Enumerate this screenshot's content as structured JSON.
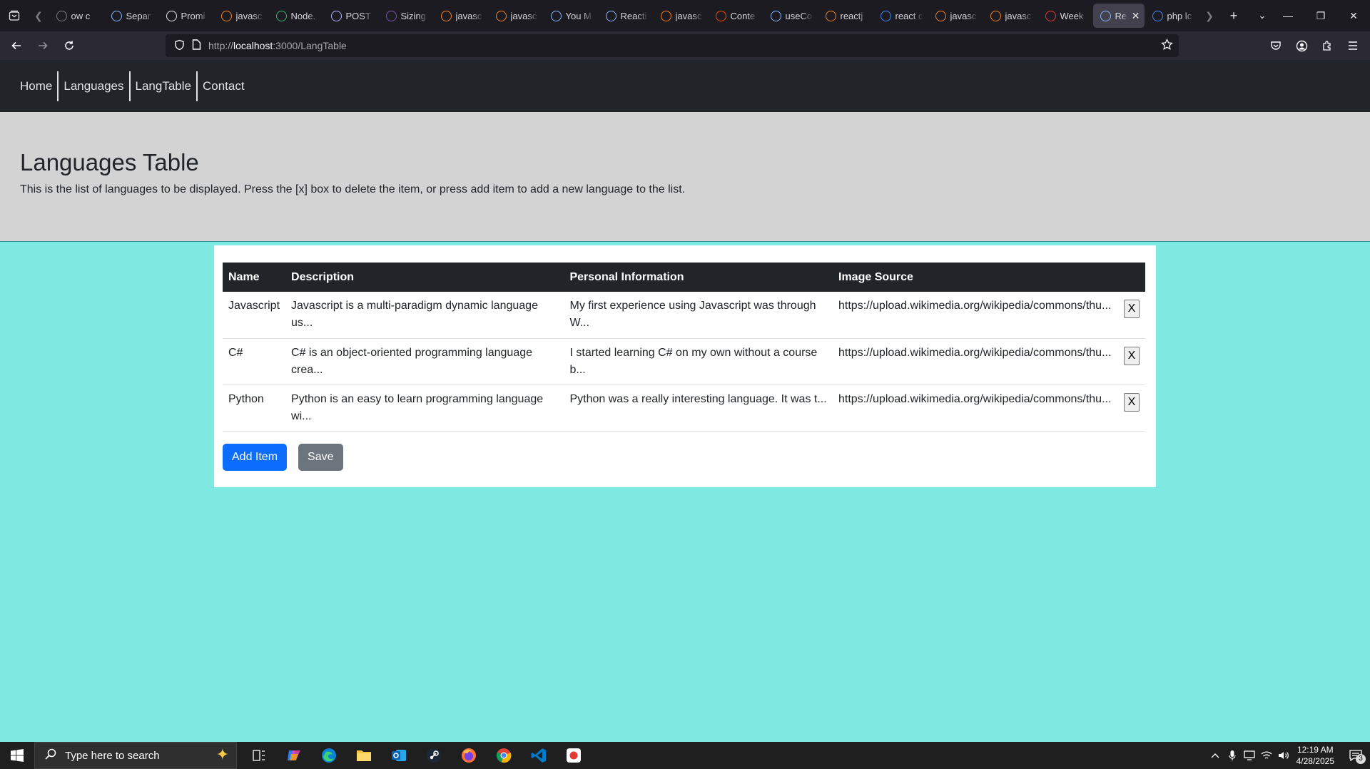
{
  "browser": {
    "tabs": [
      {
        "label": "ow c",
        "icon": "tab-icon",
        "color": "#7a7a80"
      },
      {
        "label": "Separ",
        "icon": "react-icon",
        "color": "#8ab4f8"
      },
      {
        "label": "Promi",
        "icon": "m-icon",
        "color": "#e8e8e8"
      },
      {
        "label": "javasc",
        "icon": "stackoverflow-icon",
        "color": "#f48024"
      },
      {
        "label": "Node.",
        "icon": "w-icon",
        "color": "#3cb371"
      },
      {
        "label": "POST",
        "icon": "postman-icon",
        "color": "#b0b0ff"
      },
      {
        "label": "Sizing",
        "icon": "bootstrap-icon",
        "color": "#7952b3"
      },
      {
        "label": "javasc",
        "icon": "stackoverflow-icon",
        "color": "#f48024"
      },
      {
        "label": "javasc",
        "icon": "stackoverflow-icon",
        "color": "#f48024"
      },
      {
        "label": "You M",
        "icon": "react-icon",
        "color": "#8ab4f8"
      },
      {
        "label": "Reacti",
        "icon": "react-icon",
        "color": "#8ab4f8"
      },
      {
        "label": "javasc",
        "icon": "stackoverflow-icon",
        "color": "#f48024"
      },
      {
        "label": "Conte",
        "icon": "reddit-icon",
        "color": "#ff4500"
      },
      {
        "label": "useCo",
        "icon": "react-icon",
        "color": "#8ab4f8"
      },
      {
        "label": "reactj",
        "icon": "stackoverflow-icon",
        "color": "#f48024"
      },
      {
        "label": "react c",
        "icon": "google-icon",
        "color": "#4285f4"
      },
      {
        "label": "javasc",
        "icon": "stackoverflow-icon",
        "color": "#f48024"
      },
      {
        "label": "javasc",
        "icon": "stackoverflow-icon",
        "color": "#f48024"
      },
      {
        "label": "Week",
        "icon": "week-icon",
        "color": "#e53935"
      },
      {
        "label": "Rea",
        "icon": "react-icon",
        "color": "#8ab4f8",
        "active": true
      },
      {
        "label": "php lc",
        "icon": "google-icon",
        "color": "#4285f4"
      }
    ],
    "url_prefix": "http://",
    "url_host": "localhost",
    "url_rest": ":3000/LangTable"
  },
  "site": {
    "nav": [
      "Home",
      "Languages",
      "LangTable",
      "Contact"
    ],
    "title": "Languages Table",
    "intro": "This is the list of languages to be displayed. Press the [x] box to delete the item, or press add item to add a new language to the list.",
    "table": {
      "headers": [
        "Name",
        "Description",
        "Personal Information",
        "Image Source"
      ],
      "rows": [
        {
          "name": "Javascript",
          "description": "Javascript is a multi-paradigm dynamic language us...",
          "personal": "My first experience using Javascript was through W...",
          "image": "https://upload.wikimedia.org/wikipedia/commons/thu...",
          "delete": "X"
        },
        {
          "name": "C#",
          "description": "C# is an object-oriented programming language crea...",
          "personal": "I started learning C# on my own without a course b...",
          "image": "https://upload.wikimedia.org/wikipedia/commons/thu...",
          "delete": "X"
        },
        {
          "name": "Python",
          "description": "Python is an easy to learn programming language wi...",
          "personal": "Python was a really interesting language. It was t...",
          "image": "https://upload.wikimedia.org/wikipedia/commons/thu...",
          "delete": "X"
        }
      ]
    },
    "add_label": "Add Item",
    "save_label": "Save"
  },
  "taskbar": {
    "search_placeholder": "Type here to search",
    "time": "12:19 AM",
    "date": "4/28/2025",
    "notification_count": "3"
  },
  "colors": {
    "page_background": "#7de9e0",
    "navbar": "#212529",
    "jumbotron": "#d3d3d3",
    "primary": "#0d6efd",
    "secondary": "#6c757d"
  }
}
